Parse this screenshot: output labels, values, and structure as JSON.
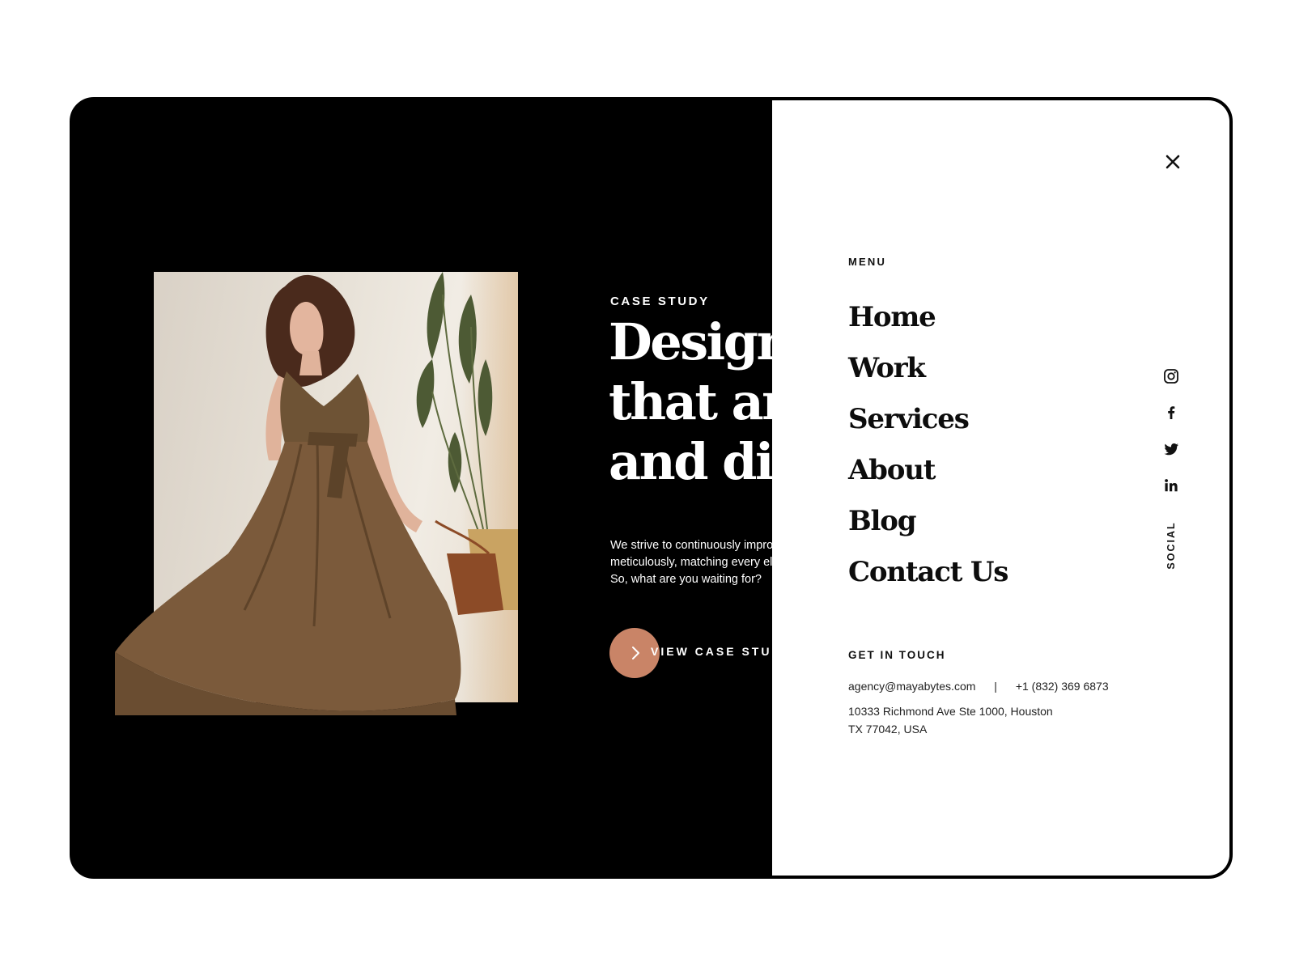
{
  "hero": {
    "eyebrow": "CASE STUDY",
    "headline_lines": [
      "Design",
      "that are",
      "and dis"
    ],
    "body": "We strive to continuously impro\nmeticulously, matching every el\nSo, what are you waiting for?",
    "cta_label": "VIEW CASE STUD",
    "cta_color": "#c98467"
  },
  "menu": {
    "heading": "MENU",
    "items": [
      "Home",
      "Work",
      "Services",
      "About",
      "Blog",
      "Contact Us"
    ],
    "close_icon": "close-icon"
  },
  "social": {
    "label": "SOCIAL",
    "icons": [
      "instagram-icon",
      "facebook-icon",
      "twitter-icon",
      "linkedin-icon"
    ]
  },
  "contact": {
    "heading": "GET IN TOUCH",
    "email": "agency@mayabytes.com",
    "separator": "|",
    "phone": "+1 (832) 369 6873",
    "address": "10333 Richmond Ave Ste 1000, Houston\nTX 77042, USA"
  }
}
